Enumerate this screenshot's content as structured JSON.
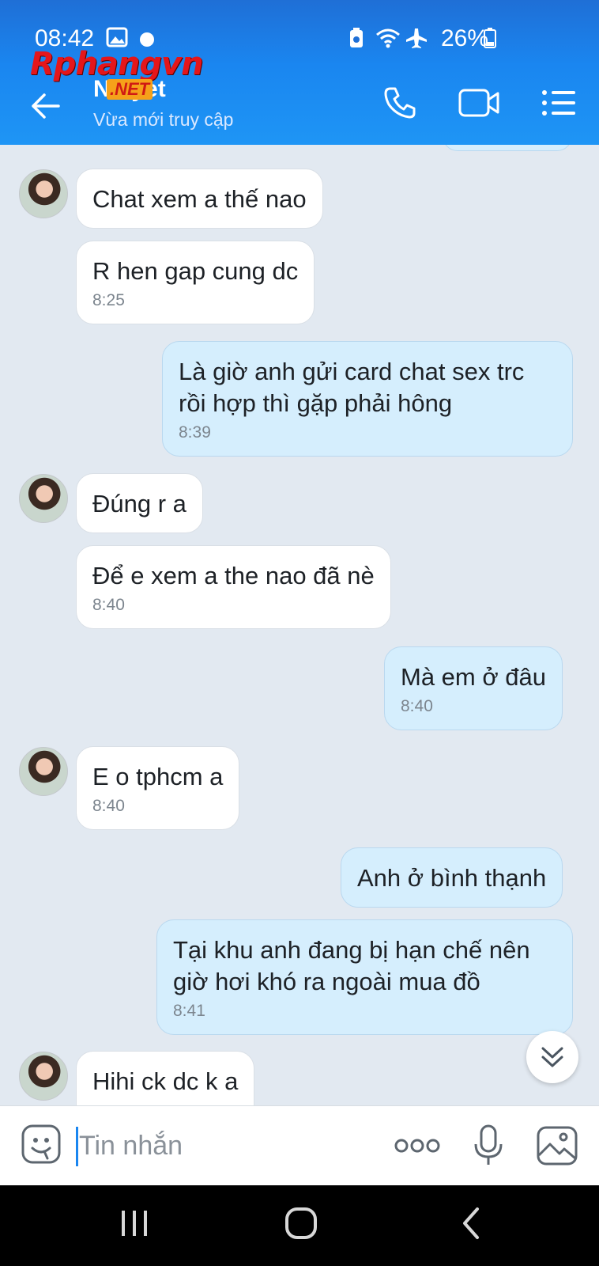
{
  "status_bar": {
    "time": "08:42",
    "battery": "26%",
    "icons": [
      "image-icon",
      "messenger-dot-icon",
      "battery-saver-icon",
      "wifi-icon",
      "airplane-icon",
      "battery-icon"
    ]
  },
  "watermark": {
    "brand": "Rphangvn",
    "tag": ".NET"
  },
  "header": {
    "contact_name": "N  uyet",
    "contact_status": "Vừa mới truy cập",
    "back_icon": "arrow-left-icon",
    "actions": [
      "phone-icon",
      "video-call-icon",
      "menu-list-icon"
    ]
  },
  "messages": [
    {
      "side": "in",
      "text": "Chat xem a thế nao",
      "time": ""
    },
    {
      "side": "in",
      "text": "R hen gap cung dc",
      "time": "8:25"
    },
    {
      "side": "out",
      "text": "Là giờ anh gửi card chat sex trc rồi hợp thì gặp phải hông",
      "time": "8:39"
    },
    {
      "side": "in",
      "text": "Đúng r a",
      "time": ""
    },
    {
      "side": "in",
      "text": "Để e xem a the nao đã nè",
      "time": "8:40"
    },
    {
      "side": "out",
      "text": "Mà em ở đâu",
      "time": "8:40"
    },
    {
      "side": "in",
      "text": "E o tphcm a",
      "time": "8:40"
    },
    {
      "side": "out",
      "text": "Anh ở bình thạnh",
      "time": ""
    },
    {
      "side": "out",
      "text": "Tại khu anh đang bị hạn chế nên giờ hơi khó ra ngoài mua đồ",
      "time": "8:41"
    },
    {
      "side": "in",
      "text": "Hihi ck dc k a",
      "time": ""
    }
  ],
  "composer": {
    "placeholder": "Tin nhắn",
    "icons": [
      "sticker-icon",
      "more-dots-icon",
      "microphone-icon",
      "gallery-icon"
    ]
  },
  "navigation": [
    "recent-apps-icon",
    "home-icon",
    "back-icon"
  ],
  "colors": {
    "header": "#1a86f0",
    "chat_background": "#e2e9f1",
    "incoming_bubble": "#ffffff",
    "outgoing_bubble": "#d5eefd"
  }
}
